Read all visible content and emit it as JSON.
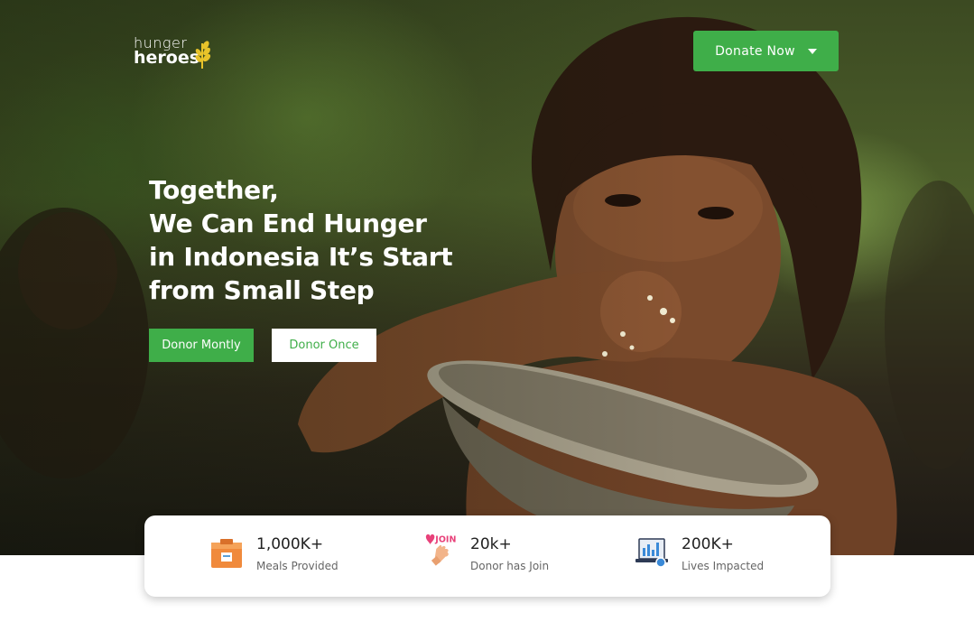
{
  "brand": {
    "logo_top": "hunger",
    "logo_bottom": "heroes",
    "accent_color": "#3fae49",
    "logo_icon": "wheat-icon"
  },
  "header": {
    "donate_label": "Donate Now",
    "donate_icon": "caret-down-icon"
  },
  "hero": {
    "headline_lines": [
      "Together,",
      "We Can End Hunger",
      "in Indonesia It’s Start",
      "from Small Step"
    ],
    "image": "child-eating-from-bowl-photo",
    "primary_cta": "Donor Montly",
    "secondary_cta": "Donor Once"
  },
  "stats": [
    {
      "value": "1,000K+",
      "label": "Meals Provided",
      "icon": "meal-box-icon"
    },
    {
      "value": "20k+",
      "label": "Donor has Join",
      "icon": "join-hand-icon",
      "icon_text": "JOIN"
    },
    {
      "value": "200K+",
      "label": "Lives Impacted",
      "icon": "report-laptop-icon"
    }
  ]
}
